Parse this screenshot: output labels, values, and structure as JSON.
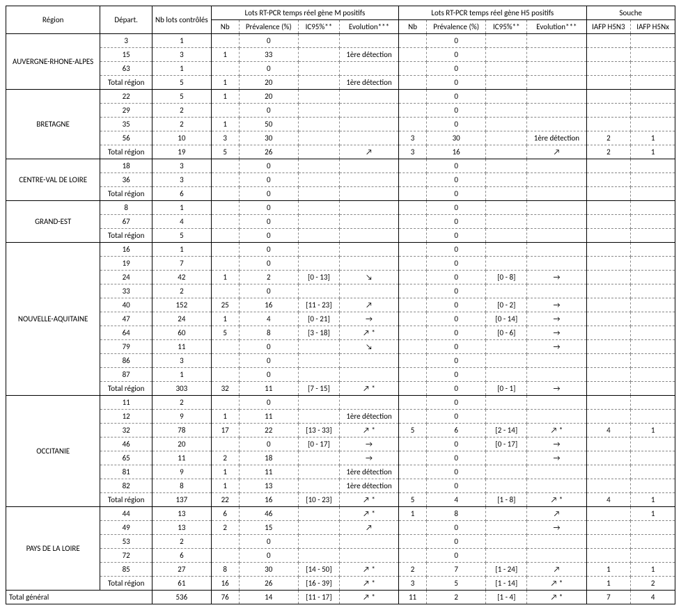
{
  "headers": {
    "region": "Région",
    "depart": "Départ.",
    "nblots": "Nb lots contrôlés",
    "gM": "Lots RT-PCR temps réel gène M positifs",
    "gH5": "Lots RT-PCR temps réel gène H5 positifs",
    "souche": "Souche",
    "nb": "Nb",
    "prev": "Prévalence (%)",
    "ic": "IC95%**",
    "evo": "Evolution***",
    "s1": "IAFP H5N3",
    "s2": "IAFP H5Nx"
  },
  "regions": [
    {
      "name": "AUVERGNE-RHONE-ALPES",
      "rows": [
        {
          "dep": "3",
          "nbl": "1",
          "mnb": "",
          "mprev": "0",
          "mic": "",
          "mevo": "",
          "hnb": "",
          "hprev": "0",
          "hic": "",
          "hevo": "",
          "s1": "",
          "s2": ""
        },
        {
          "dep": "15",
          "nbl": "3",
          "mnb": "1",
          "mprev": "33",
          "mic": "",
          "mevo": "1ère détection",
          "hnb": "",
          "hprev": "0",
          "hic": "",
          "hevo": "",
          "s1": "",
          "s2": ""
        },
        {
          "dep": "63",
          "nbl": "1",
          "mnb": "",
          "mprev": "0",
          "mic": "",
          "mevo": "",
          "hnb": "",
          "hprev": "0",
          "hic": "",
          "hevo": "",
          "s1": "",
          "s2": ""
        },
        {
          "dep": "Total région",
          "nbl": "5",
          "mnb": "1",
          "mprev": "20",
          "mic": "",
          "mevo": "1ère détection",
          "hnb": "",
          "hprev": "0",
          "hic": "",
          "hevo": "",
          "s1": "",
          "s2": ""
        }
      ]
    },
    {
      "name": "BRETAGNE",
      "rows": [
        {
          "dep": "22",
          "nbl": "5",
          "mnb": "1",
          "mprev": "20",
          "mic": "",
          "mevo": "",
          "hnb": "",
          "hprev": "0",
          "hic": "",
          "hevo": "",
          "s1": "",
          "s2": ""
        },
        {
          "dep": "29",
          "nbl": "2",
          "mnb": "",
          "mprev": "0",
          "mic": "",
          "mevo": "",
          "hnb": "",
          "hprev": "0",
          "hic": "",
          "hevo": "",
          "s1": "",
          "s2": ""
        },
        {
          "dep": "35",
          "nbl": "2",
          "mnb": "1",
          "mprev": "50",
          "mic": "",
          "mevo": "",
          "hnb": "",
          "hprev": "0",
          "hic": "",
          "hevo": "",
          "s1": "",
          "s2": ""
        },
        {
          "dep": "56",
          "nbl": "10",
          "mnb": "3",
          "mprev": "30",
          "mic": "",
          "mevo": "",
          "hnb": "3",
          "hprev": "30",
          "hic": "",
          "hevo": "1ère détection",
          "s1": "2",
          "s2": "1"
        },
        {
          "dep": "Total région",
          "nbl": "19",
          "mnb": "5",
          "mprev": "26",
          "mic": "",
          "mevo": "↗",
          "hnb": "3",
          "hprev": "16",
          "hic": "",
          "hevo": "↗",
          "s1": "2",
          "s2": "1"
        }
      ]
    },
    {
      "name": "CENTRE-VAL DE LOIRE",
      "rows": [
        {
          "dep": "18",
          "nbl": "3",
          "mnb": "",
          "mprev": "0",
          "mic": "",
          "mevo": "",
          "hnb": "",
          "hprev": "0",
          "hic": "",
          "hevo": "",
          "s1": "",
          "s2": ""
        },
        {
          "dep": "36",
          "nbl": "3",
          "mnb": "",
          "mprev": "0",
          "mic": "",
          "mevo": "",
          "hnb": "",
          "hprev": "0",
          "hic": "",
          "hevo": "",
          "s1": "",
          "s2": ""
        },
        {
          "dep": "Total région",
          "nbl": "6",
          "mnb": "",
          "mprev": "0",
          "mic": "",
          "mevo": "",
          "hnb": "",
          "hprev": "0",
          "hic": "",
          "hevo": "",
          "s1": "",
          "s2": ""
        }
      ]
    },
    {
      "name": "GRAND-EST",
      "rows": [
        {
          "dep": "8",
          "nbl": "1",
          "mnb": "",
          "mprev": "0",
          "mic": "",
          "mevo": "",
          "hnb": "",
          "hprev": "0",
          "hic": "",
          "hevo": "",
          "s1": "",
          "s2": ""
        },
        {
          "dep": "67",
          "nbl": "4",
          "mnb": "",
          "mprev": "0",
          "mic": "",
          "mevo": "",
          "hnb": "",
          "hprev": "0",
          "hic": "",
          "hevo": "",
          "s1": "",
          "s2": ""
        },
        {
          "dep": "Total région",
          "nbl": "5",
          "mnb": "",
          "mprev": "0",
          "mic": "",
          "mevo": "",
          "hnb": "",
          "hprev": "0",
          "hic": "",
          "hevo": "",
          "s1": "",
          "s2": ""
        }
      ]
    },
    {
      "name": "NOUVELLE-AQUITAINE",
      "rows": [
        {
          "dep": "16",
          "nbl": "1",
          "mnb": "",
          "mprev": "0",
          "mic": "",
          "mevo": "",
          "hnb": "",
          "hprev": "0",
          "hic": "",
          "hevo": "",
          "s1": "",
          "s2": ""
        },
        {
          "dep": "19",
          "nbl": "7",
          "mnb": "",
          "mprev": "0",
          "mic": "",
          "mevo": "",
          "hnb": "",
          "hprev": "0",
          "hic": "",
          "hevo": "",
          "s1": "",
          "s2": ""
        },
        {
          "dep": "24",
          "nbl": "42",
          "mnb": "1",
          "mprev": "2",
          "mic": "[0 - 13]",
          "mevo": "↘",
          "hnb": "",
          "hprev": "0",
          "hic": "[0 - 8]",
          "hevo": "→",
          "s1": "",
          "s2": ""
        },
        {
          "dep": "33",
          "nbl": "2",
          "mnb": "",
          "mprev": "0",
          "mic": "",
          "mevo": "",
          "hnb": "",
          "hprev": "0",
          "hic": "",
          "hevo": "",
          "s1": "",
          "s2": ""
        },
        {
          "dep": "40",
          "nbl": "152",
          "mnb": "25",
          "mprev": "16",
          "mic": "[11 - 23]",
          "mevo": "↗",
          "hnb": "",
          "hprev": "0",
          "hic": "[0 - 2]",
          "hevo": "→",
          "s1": "",
          "s2": ""
        },
        {
          "dep": "47",
          "nbl": "24",
          "mnb": "1",
          "mprev": "4",
          "mic": "[0 - 21]",
          "mevo": "→",
          "hnb": "",
          "hprev": "0",
          "hic": "[0 - 14]",
          "hevo": "→",
          "s1": "",
          "s2": ""
        },
        {
          "dep": "64",
          "nbl": "60",
          "mnb": "5",
          "mprev": "8",
          "mic": "[3 - 18]",
          "mevo": "↗ *",
          "hnb": "",
          "hprev": "0",
          "hic": "[0 - 6]",
          "hevo": "→",
          "s1": "",
          "s2": ""
        },
        {
          "dep": "79",
          "nbl": "11",
          "mnb": "",
          "mprev": "0",
          "mic": "",
          "mevo": "↘",
          "hnb": "",
          "hprev": "0",
          "hic": "",
          "hevo": "→",
          "s1": "",
          "s2": ""
        },
        {
          "dep": "86",
          "nbl": "3",
          "mnb": "",
          "mprev": "0",
          "mic": "",
          "mevo": "",
          "hnb": "",
          "hprev": "0",
          "hic": "",
          "hevo": "",
          "s1": "",
          "s2": ""
        },
        {
          "dep": "87",
          "nbl": "1",
          "mnb": "",
          "mprev": "0",
          "mic": "",
          "mevo": "",
          "hnb": "",
          "hprev": "0",
          "hic": "",
          "hevo": "",
          "s1": "",
          "s2": ""
        },
        {
          "dep": "Total région",
          "nbl": "303",
          "mnb": "32",
          "mprev": "11",
          "mic": "[7 - 15]",
          "mevo": "↗ *",
          "hnb": "",
          "hprev": "0",
          "hic": "[0 - 1]",
          "hevo": "→",
          "s1": "",
          "s2": ""
        }
      ]
    },
    {
      "name": "OCCITANIE",
      "rows": [
        {
          "dep": "11",
          "nbl": "2",
          "mnb": "",
          "mprev": "0",
          "mic": "",
          "mevo": "",
          "hnb": "",
          "hprev": "0",
          "hic": "",
          "hevo": "",
          "s1": "",
          "s2": ""
        },
        {
          "dep": "12",
          "nbl": "9",
          "mnb": "1",
          "mprev": "11",
          "mic": "",
          "mevo": "1ère détection",
          "hnb": "",
          "hprev": "0",
          "hic": "",
          "hevo": "",
          "s1": "",
          "s2": ""
        },
        {
          "dep": "32",
          "nbl": "78",
          "mnb": "17",
          "mprev": "22",
          "mic": "[13 - 33]",
          "mevo": "↗ *",
          "hnb": "5",
          "hprev": "6",
          "hic": "[2 - 14]",
          "hevo": "↗ *",
          "s1": "4",
          "s2": "1"
        },
        {
          "dep": "46",
          "nbl": "20",
          "mnb": "",
          "mprev": "0",
          "mic": "[0 - 17]",
          "mevo": "→",
          "hnb": "",
          "hprev": "0",
          "hic": "[0 - 17]",
          "hevo": "→",
          "s1": "",
          "s2": ""
        },
        {
          "dep": "65",
          "nbl": "11",
          "mnb": "2",
          "mprev": "18",
          "mic": "",
          "mevo": "→",
          "hnb": "",
          "hprev": "0",
          "hic": "",
          "hevo": "→",
          "s1": "",
          "s2": ""
        },
        {
          "dep": "81",
          "nbl": "9",
          "mnb": "1",
          "mprev": "11",
          "mic": "",
          "mevo": "1ère détection",
          "hnb": "",
          "hprev": "0",
          "hic": "",
          "hevo": "",
          "s1": "",
          "s2": ""
        },
        {
          "dep": "82",
          "nbl": "8",
          "mnb": "1",
          "mprev": "13",
          "mic": "",
          "mevo": "1ère détection",
          "hnb": "",
          "hprev": "0",
          "hic": "",
          "hevo": "",
          "s1": "",
          "s2": ""
        },
        {
          "dep": "Total région",
          "nbl": "137",
          "mnb": "22",
          "mprev": "16",
          "mic": "[10 - 23]",
          "mevo": "↗ *",
          "hnb": "5",
          "hprev": "4",
          "hic": "[1 - 8]",
          "hevo": "↗ *",
          "s1": "4",
          "s2": "1"
        }
      ]
    },
    {
      "name": "PAYS DE LA LOIRE",
      "rows": [
        {
          "dep": "44",
          "nbl": "13",
          "mnb": "6",
          "mprev": "46",
          "mic": "",
          "mevo": "↗ *",
          "hnb": "1",
          "hprev": "8",
          "hic": "",
          "hevo": "↗",
          "s1": "",
          "s2": "1"
        },
        {
          "dep": "49",
          "nbl": "13",
          "mnb": "2",
          "mprev": "15",
          "mic": "",
          "mevo": "↗",
          "hnb": "",
          "hprev": "0",
          "hic": "",
          "hevo": "→",
          "s1": "",
          "s2": ""
        },
        {
          "dep": "53",
          "nbl": "2",
          "mnb": "",
          "mprev": "0",
          "mic": "",
          "mevo": "",
          "hnb": "",
          "hprev": "0",
          "hic": "",
          "hevo": "",
          "s1": "",
          "s2": ""
        },
        {
          "dep": "72",
          "nbl": "6",
          "mnb": "",
          "mprev": "0",
          "mic": "",
          "mevo": "",
          "hnb": "",
          "hprev": "0",
          "hic": "",
          "hevo": "",
          "s1": "",
          "s2": ""
        },
        {
          "dep": "85",
          "nbl": "27",
          "mnb": "8",
          "mprev": "30",
          "mic": "[14 - 50]",
          "mevo": "↗ *",
          "hnb": "2",
          "hprev": "7",
          "hic": "[1 - 24]",
          "hevo": "↗",
          "s1": "1",
          "s2": "1"
        },
        {
          "dep": "Total région",
          "nbl": "61",
          "mnb": "16",
          "mprev": "26",
          "mic": "[16 - 39]",
          "mevo": "↗ *",
          "hnb": "3",
          "hprev": "5",
          "hic": "[1 - 14]",
          "hevo": "↗ *",
          "s1": "1",
          "s2": "2"
        }
      ]
    }
  ],
  "grand_total": {
    "label": "Total général",
    "nbl": "536",
    "mnb": "76",
    "mprev": "14",
    "mic": "[11 - 17]",
    "mevo": "↗ *",
    "hnb": "11",
    "hprev": "2",
    "hic": "[1 - 4]",
    "hevo": "↗ *",
    "s1": "7",
    "s2": "4"
  }
}
